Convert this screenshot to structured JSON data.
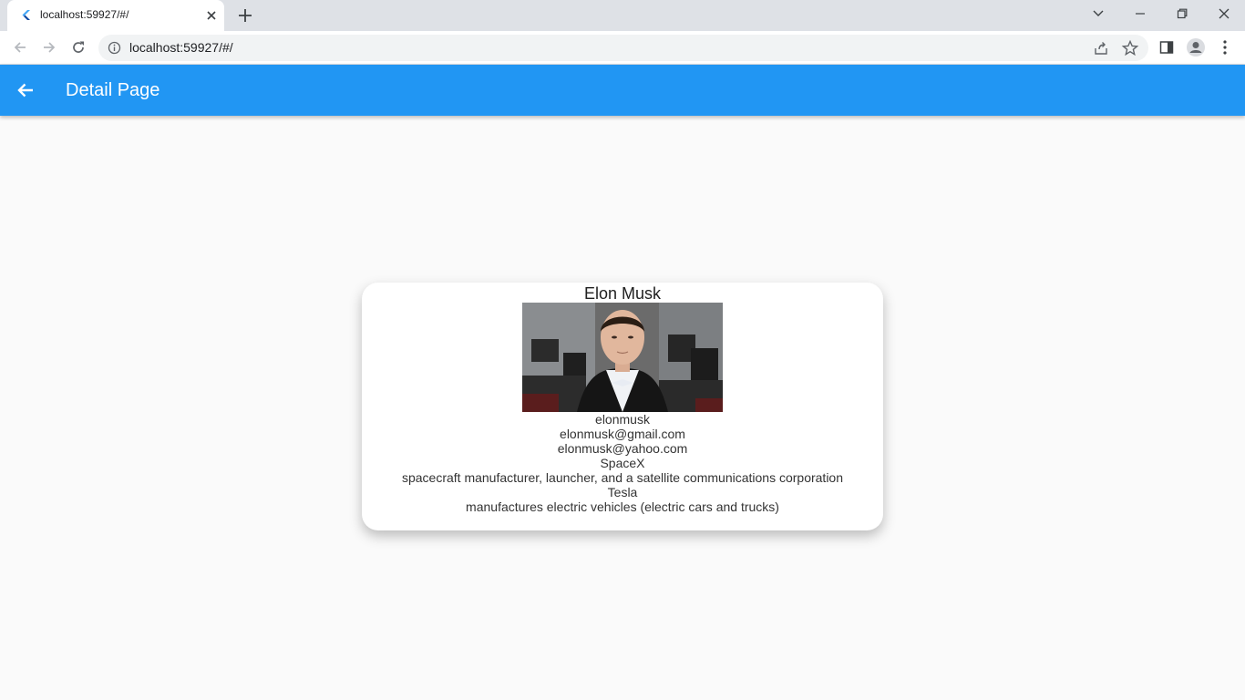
{
  "browser": {
    "tab_title": "localhost:59927/#/",
    "url": "localhost:59927/#/"
  },
  "appbar": {
    "title": "Detail Page",
    "color": "#2196f3"
  },
  "profile": {
    "name": "Elon Musk",
    "photo_alt": "Elon Musk",
    "username": "elonmusk",
    "email_primary": "elonmusk@gmail.com",
    "email_secondary": "elonmusk@yahoo.com",
    "companies": [
      {
        "name": "SpaceX",
        "description": "spacecraft manufacturer, launcher, and a satellite communications corporation"
      },
      {
        "name": "Tesla",
        "description": "manufactures electric vehicles (electric cars and trucks)"
      }
    ]
  }
}
